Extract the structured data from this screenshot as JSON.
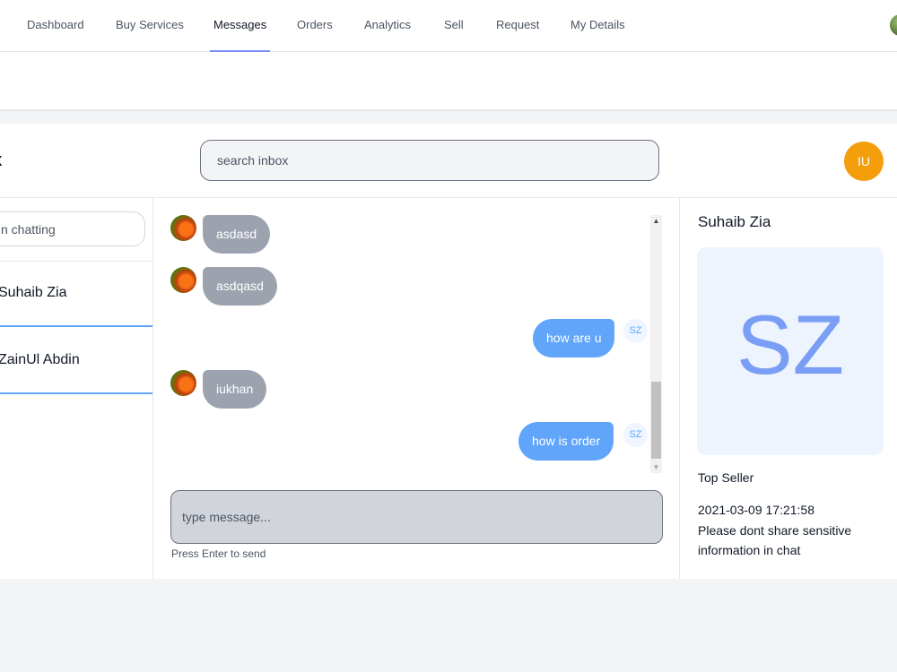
{
  "nav": {
    "items": [
      {
        "label": "Dashboard"
      },
      {
        "label": "Buy Services"
      },
      {
        "label": "Messages"
      },
      {
        "label": "Orders"
      },
      {
        "label": "Analytics"
      },
      {
        "label": "Sell"
      },
      {
        "label": "Request"
      },
      {
        "label": "My Details"
      }
    ],
    "active": "Messages",
    "active_color": "#818cf8"
  },
  "inbox": {
    "title": "ox",
    "search_placeholder": "search inbox",
    "user_initials": "IU",
    "user_badge_color": "#f59e0b"
  },
  "contacts": {
    "search_placeholder": "n chatting",
    "items": [
      {
        "name": "Suhaib Zia"
      },
      {
        "name": "ZainUl Abdin"
      }
    ]
  },
  "chat": {
    "messages": [
      {
        "direction": "in",
        "text": "asdasd"
      },
      {
        "direction": "in",
        "text": "asdqasd"
      },
      {
        "direction": "out",
        "text": "how are u",
        "avatar": "SZ"
      },
      {
        "direction": "in",
        "text": "iukhan"
      },
      {
        "direction": "out",
        "text": "how is order",
        "avatar": "SZ"
      }
    ],
    "composer_placeholder": "type message...",
    "hint": "Press Enter to send",
    "incoming_color": "#9ca3af",
    "outgoing_color": "#60a5fa"
  },
  "profile": {
    "name": "Suhaib Zia",
    "initials": "SZ",
    "role": "Top Seller",
    "date": "2021-03-09 17:21:58",
    "note": "Please dont share sensitive information in chat"
  }
}
